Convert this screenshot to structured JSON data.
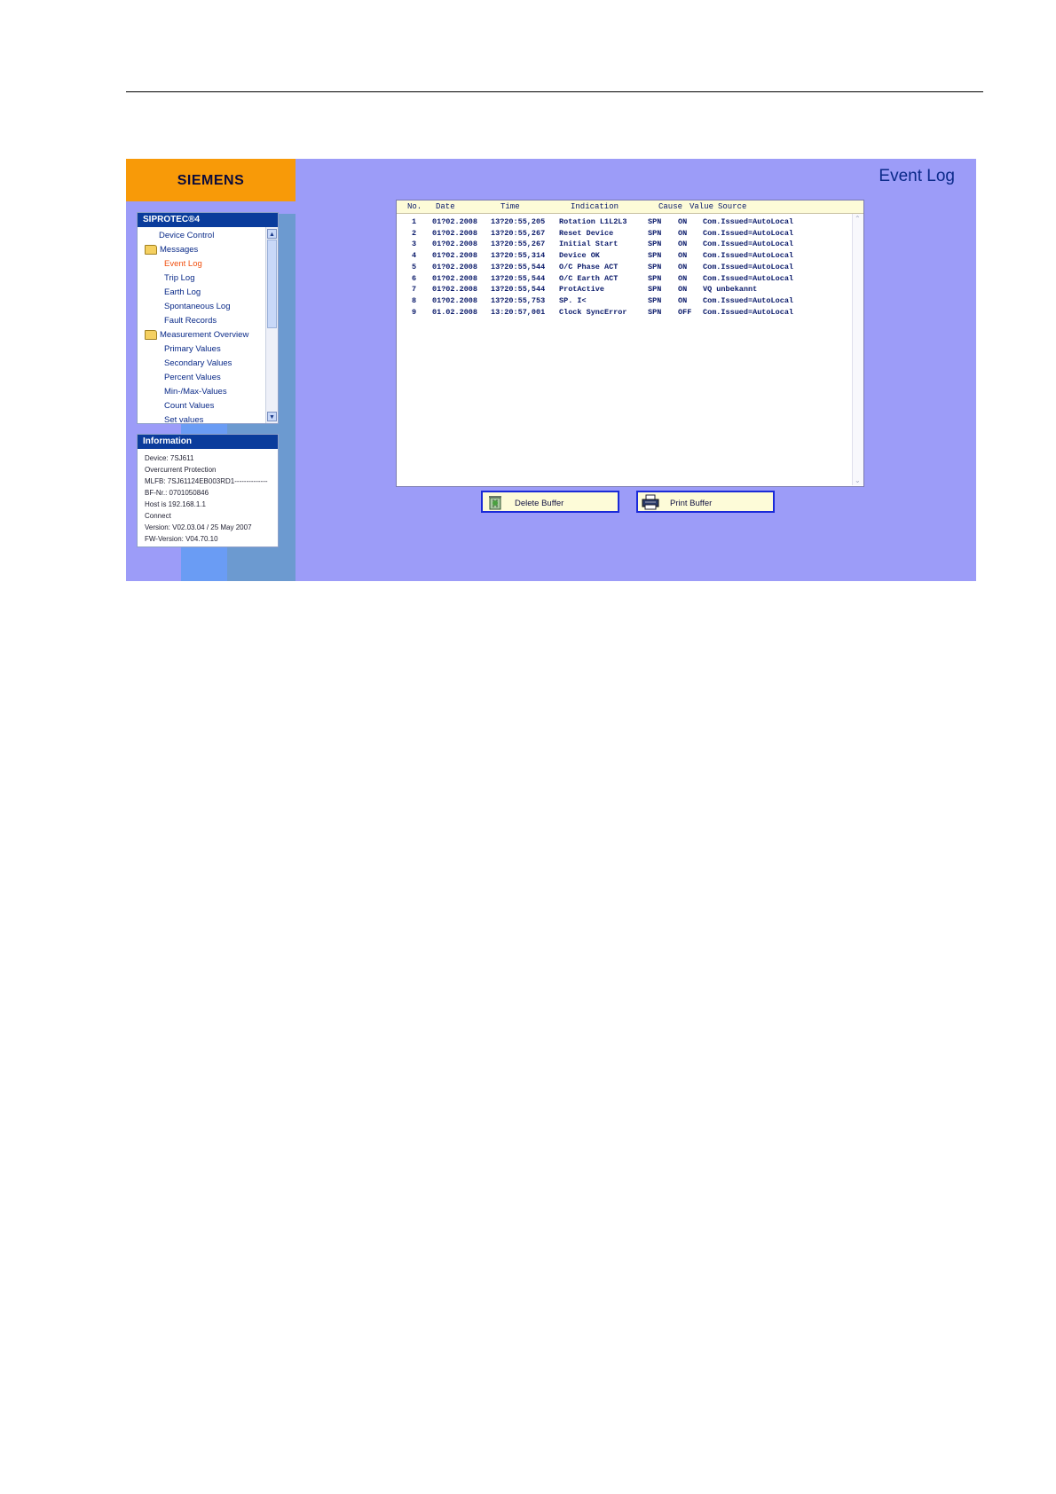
{
  "brand": {
    "logo": "SIEMENS"
  },
  "nav": {
    "title": "SIPROTEC®4",
    "items": [
      {
        "label": "Device Control",
        "folder": false,
        "indent": 1,
        "active": false
      },
      {
        "label": "Messages",
        "folder": true,
        "indent": 0,
        "active": false
      },
      {
        "label": "Event Log",
        "folder": false,
        "indent": 2,
        "active": true
      },
      {
        "label": "Trip Log",
        "folder": false,
        "indent": 2,
        "active": false
      },
      {
        "label": "Earth Log",
        "folder": false,
        "indent": 2,
        "active": false
      },
      {
        "label": "Spontaneous Log",
        "folder": false,
        "indent": 2,
        "active": false
      },
      {
        "label": "Fault Records",
        "folder": false,
        "indent": 2,
        "active": false
      },
      {
        "label": "Measurement Overview",
        "folder": true,
        "indent": 0,
        "active": false
      },
      {
        "label": "Primary Values",
        "folder": false,
        "indent": 2,
        "active": false
      },
      {
        "label": "Secondary Values",
        "folder": false,
        "indent": 2,
        "active": false
      },
      {
        "label": "Percent Values",
        "folder": false,
        "indent": 2,
        "active": false
      },
      {
        "label": "Min-/Max-Values",
        "folder": false,
        "indent": 2,
        "active": false
      },
      {
        "label": "Count Values",
        "folder": false,
        "indent": 2,
        "active": false
      },
      {
        "label": "Set values",
        "folder": false,
        "indent": 2,
        "active": false
      }
    ],
    "scroll_up": "▲",
    "scroll_down": "▼"
  },
  "info": {
    "title": "Information",
    "lines": [
      "Device: 7SJ611",
      "Overcurrent Protection",
      "MLFB: 7SJ61124EB003RD1--------------",
      "BF-Nr.: 0701050846",
      "Host is 192.168.1.1",
      "Connect",
      "Version: V02.03.04 / 25 May 2007",
      "FW-Version: V04.70.10"
    ]
  },
  "page": {
    "title": "Event Log"
  },
  "log": {
    "columns": [
      "No.",
      "Date",
      "Time",
      "Indication",
      "Cause",
      "Value",
      "Source"
    ],
    "rows": [
      [
        "1",
        "01?02.2008",
        "13?20:55,205",
        "Rotation L1L2L3",
        "SPN",
        "ON",
        "Com.Issued=AutoLocal"
      ],
      [
        "2",
        "01?02.2008",
        "13?20:55,267",
        "Reset Device",
        "SPN",
        "ON",
        "Com.Issued=AutoLocal"
      ],
      [
        "3",
        "01?02.2008",
        "13?20:55,267",
        "Initial Start",
        "SPN",
        "ON",
        "Com.Issued=AutoLocal"
      ],
      [
        "4",
        "01?02.2008",
        "13?20:55,314",
        "Device OK",
        "SPN",
        "ON",
        "Com.Issued=AutoLocal"
      ],
      [
        "5",
        "01?02.2008",
        "13?20:55,544",
        "O/C Phase ACT",
        "SPN",
        "ON",
        "Com.Issued=AutoLocal"
      ],
      [
        "6",
        "01?02.2008",
        "13?20:55,544",
        "O/C Earth ACT",
        "SPN",
        "ON",
        "Com.Issued=AutoLocal"
      ],
      [
        "7",
        "01?02.2008",
        "13?20:55,544",
        "ProtActive",
        "SPN",
        "ON",
        "VQ unbekannt"
      ],
      [
        "8",
        "01?02.2008",
        "13?20:55,753",
        "SP. I<",
        "SPN",
        "ON",
        "Com.Issued=AutoLocal"
      ],
      [
        "9",
        "01.02.2008",
        "13:20:57,001",
        "Clock SyncError",
        "SPN",
        "OFF",
        "Com.Issued=AutoLocal"
      ]
    ]
  },
  "buttons": {
    "delete": "Delete Buffer",
    "print": "Print Buffer"
  },
  "colors": {
    "background": "#9c9cf8",
    "logo_bar": "#f89a08",
    "panel_header": "#0a3c9c",
    "active_nav": "#f05010"
  }
}
